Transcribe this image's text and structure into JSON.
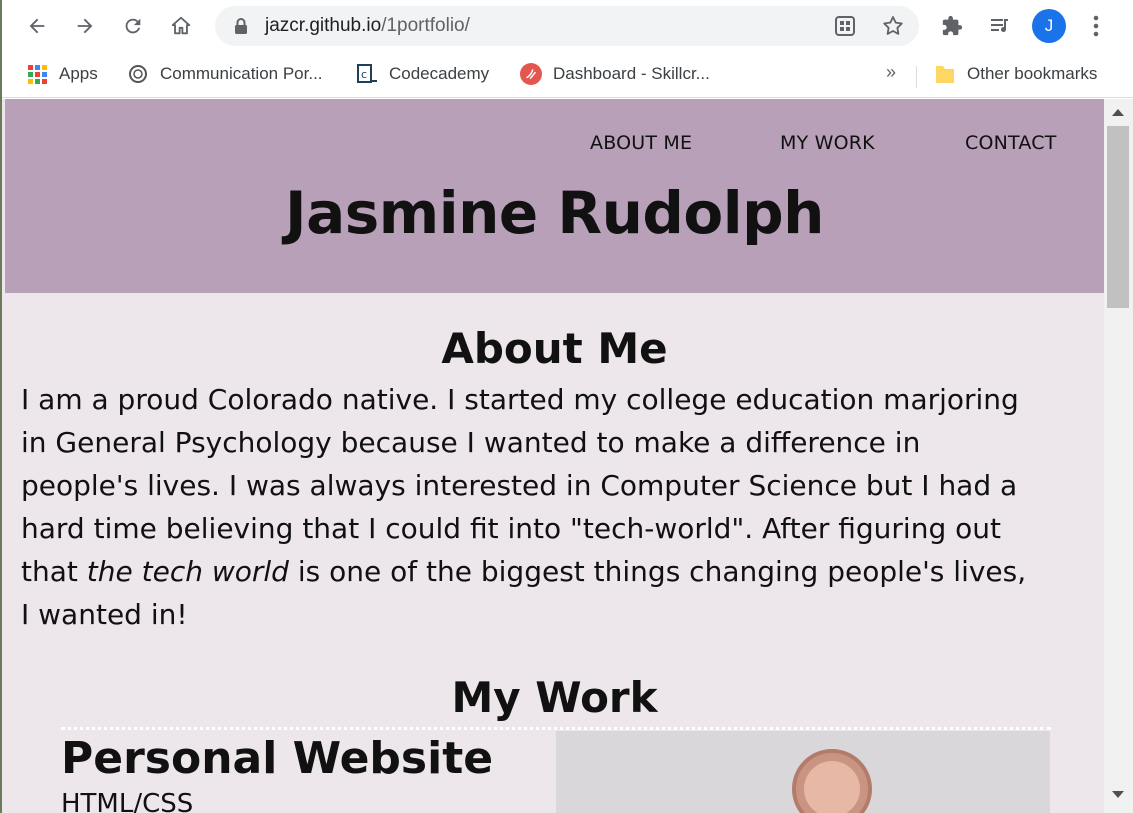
{
  "browser": {
    "url_host": "jazcr.github.io",
    "url_path": "/1portfolio/",
    "profile_initial": "J",
    "accent_color": "#1a73e8"
  },
  "bookmarks": {
    "items": [
      {
        "label": "Apps",
        "icon": "apps-grid-icon"
      },
      {
        "label": "Communication Por...",
        "icon": "swirl-icon"
      },
      {
        "label": "Codecademy",
        "icon": "codecademy-icon"
      },
      {
        "label": "Dashboard - Skillcr...",
        "icon": "skillcrush-icon"
      }
    ],
    "overflow": "»",
    "other": "Other bookmarks"
  },
  "site": {
    "nav": [
      "ABOUT ME",
      "MY WORK",
      "CONTACT"
    ],
    "title": "Jasmine Rudolph",
    "header_color": "#b7a0b8",
    "bg_color": "#ede6eb",
    "about": {
      "heading": "About Me",
      "text_before": "I am a proud Colorado native. I started my college education marjoring in General Psychology because I wanted to make a difference in people's lives. I was always interested in Computer Science but I had a hard time believing that I could fit into \"tech-world\". After figuring out that ",
      "text_em": "the tech world",
      "text_after": " is one of the biggest things changing people's lives, I wanted in!"
    },
    "work": {
      "heading": "My Work",
      "project_title": "Personal Website",
      "project_sub": "HTML/CSS"
    }
  }
}
